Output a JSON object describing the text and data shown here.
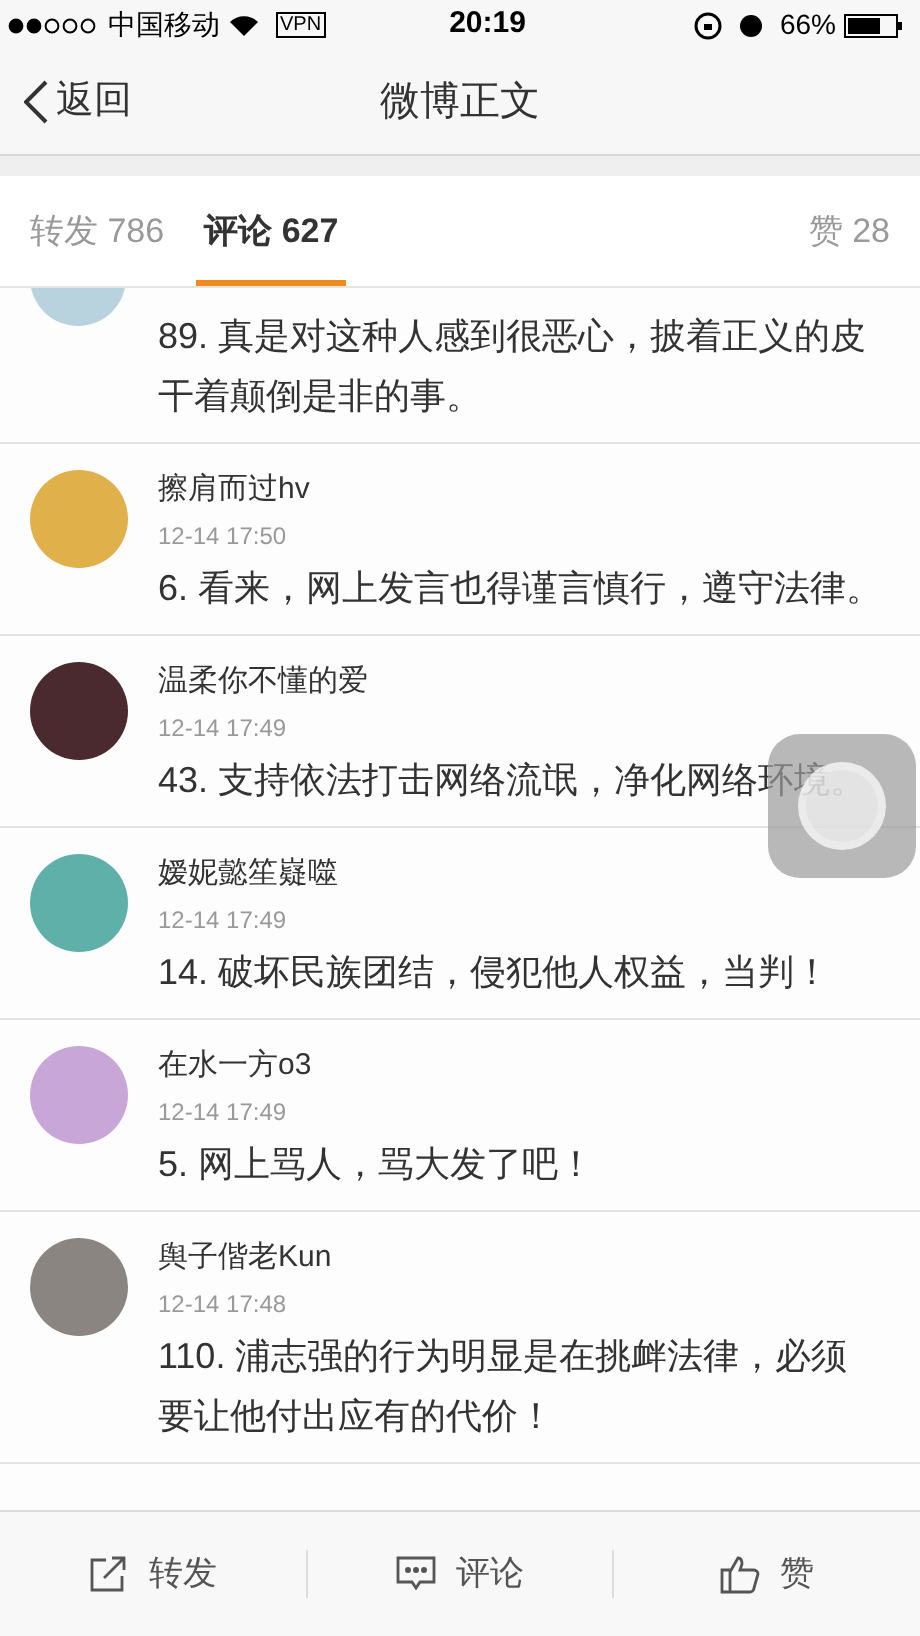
{
  "status_bar": {
    "carrier": "中国移动",
    "vpn": "VPN",
    "time": "20:19",
    "battery": "66%"
  },
  "nav": {
    "back": "返回",
    "title": "微博正文"
  },
  "tabs": [
    {
      "label": "转发 786",
      "selected": false
    },
    {
      "label": "评论 627",
      "selected": true
    },
    {
      "label": "赞 28",
      "selected": false
    }
  ],
  "comments": [
    {
      "kind": "cut",
      "text": "89. 真是对这种人感到很恶心，披着正义的皮干着颠倒是非的事。"
    },
    {
      "kind": "full",
      "name": "擦肩而过hv",
      "time": "12-14 17:50",
      "text": "6. 看来，网上发言也得谨言慎行，遵守法律。"
    },
    {
      "kind": "full",
      "name": "温柔你不懂的爱",
      "time": "12-14 17:49",
      "text": "43. 支持依法打击网络流氓，净化网络环境。"
    },
    {
      "kind": "full",
      "name": "嫒妮懿笙嶷噬",
      "time": "12-14 17:49",
      "text": "14. 破坏民族团结，侵犯他人权益，当判！"
    },
    {
      "kind": "full",
      "name": "在水一方o3",
      "time": "12-14 17:49",
      "text": "5. 网上骂人，骂大发了吧！"
    },
    {
      "kind": "full",
      "name": "舆子偕老Kun",
      "time": "12-14 17:48",
      "text": "110. 浦志强的行为明显是在挑衅法律，必须要让他付出应有的代价！"
    }
  ],
  "toolbar": [
    {
      "kind": "share",
      "label": "转发"
    },
    {
      "kind": "comment",
      "label": "评论"
    },
    {
      "kind": "like",
      "label": "赞"
    }
  ]
}
